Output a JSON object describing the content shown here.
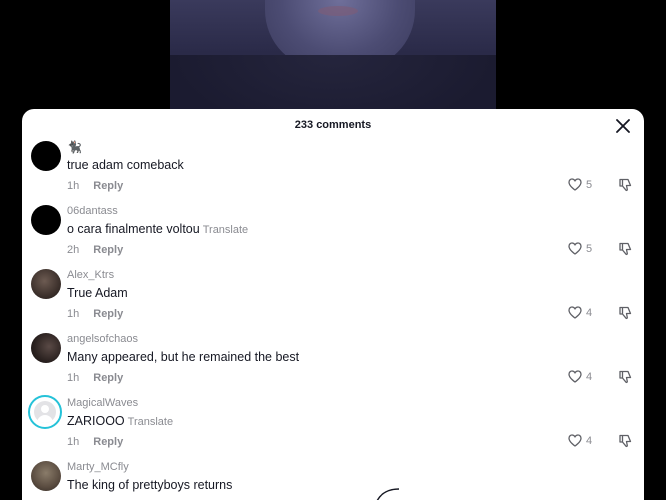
{
  "sheet": {
    "title": "233 comments"
  },
  "reply_label": "Reply",
  "translate_label": "Translate",
  "colors": {
    "accent_ring": "#25c2d8",
    "muted_text": "#8a8b91",
    "primary_text": "#161823"
  },
  "comments": [
    {
      "username": "🐈‍⬛",
      "text": "true adam comeback",
      "time": "1h",
      "likes": "5",
      "translate": false,
      "avatar": "black"
    },
    {
      "username": "06dantass",
      "text": "o cara finalmente voltou",
      "time": "2h",
      "likes": "5",
      "translate": true,
      "avatar": "black"
    },
    {
      "username": "Alex_Ktrs",
      "text": "True Adam",
      "time": "1h",
      "likes": "4",
      "translate": false,
      "avatar": "photo"
    },
    {
      "username": "angelsofchaos",
      "text": "Many appeared, but he remained the best",
      "time": "1h",
      "likes": "4",
      "translate": false,
      "avatar": "photo"
    },
    {
      "username": "MagicalWaves",
      "text": "ZARIOOO",
      "time": "1h",
      "likes": "4",
      "translate": true,
      "avatar": "default"
    },
    {
      "username": "Marty_MCfly",
      "text": "The king of prettyboys returns",
      "time": "",
      "likes": "",
      "translate": false,
      "avatar": "photo"
    }
  ]
}
